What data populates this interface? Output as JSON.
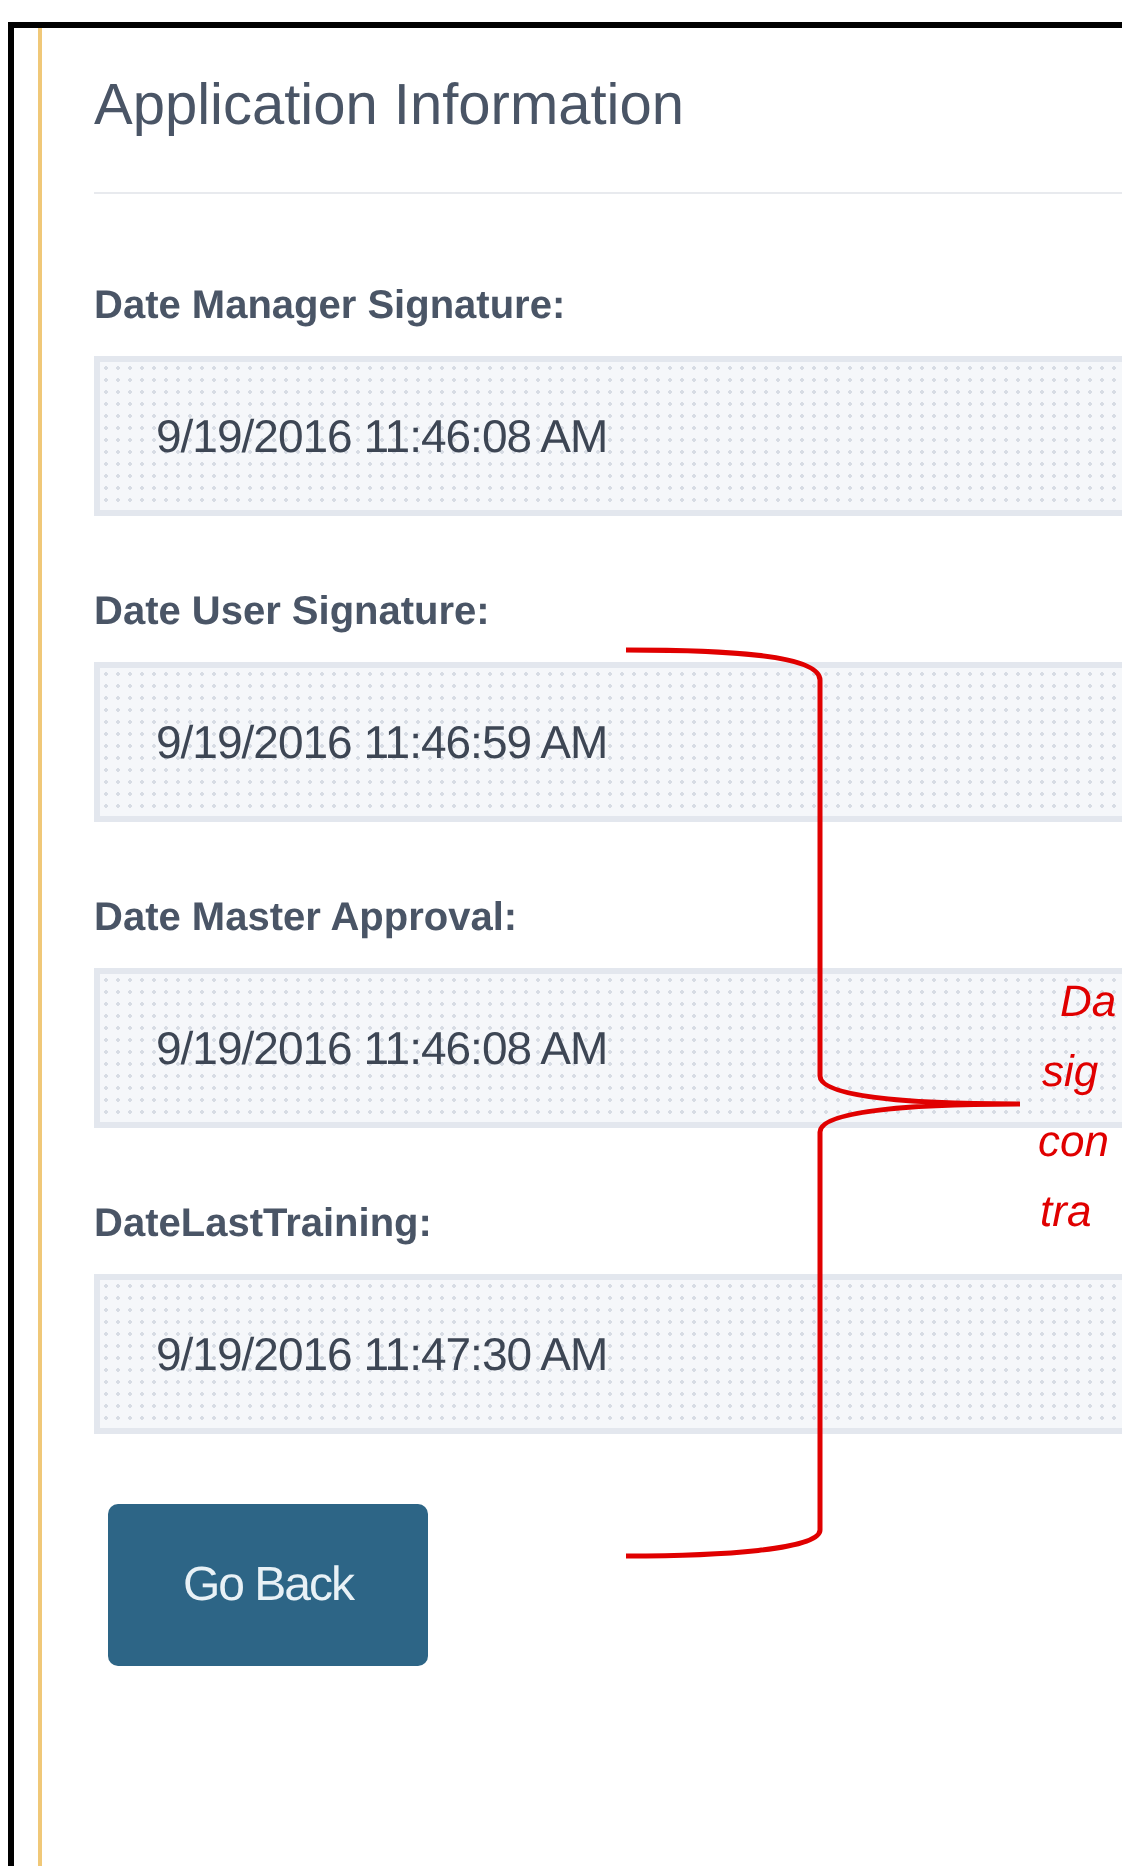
{
  "panel": {
    "title": "Application Information"
  },
  "fields": [
    {
      "label": "Date Manager Signature:",
      "value": "9/19/2016 11:46:08 AM"
    },
    {
      "label": "Date User Signature:",
      "value": "9/19/2016 11:46:59 AM"
    },
    {
      "label": "Date Master Approval:",
      "value": "9/19/2016 11:46:08 AM"
    },
    {
      "label": "DateLastTraining:",
      "value": "9/19/2016 11:47:30 AM"
    }
  ],
  "buttons": [
    "Go Back"
  ],
  "annotation": {
    "lines": [
      "Da",
      "sig",
      "con",
      "tra"
    ]
  }
}
